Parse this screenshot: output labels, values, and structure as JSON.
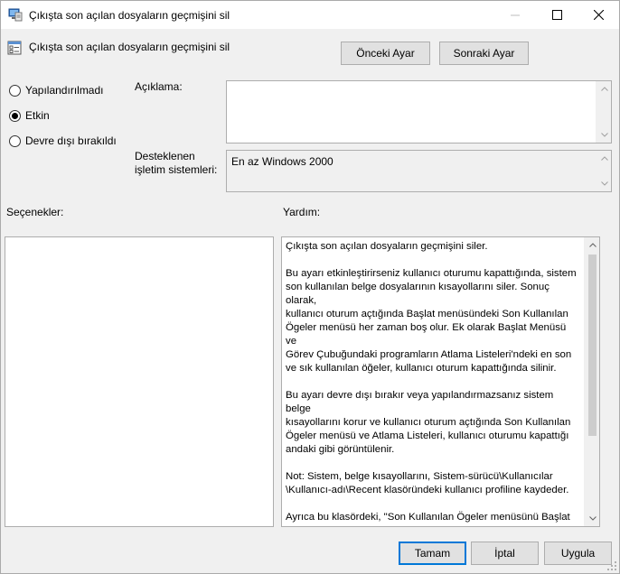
{
  "window": {
    "title": "Çıkışta son açılan dosyaların geçmişini sil",
    "controls": {
      "minimize": "minimize-icon",
      "maximize": "maximize-icon",
      "close": "close-icon"
    }
  },
  "header": {
    "setting_title": "Çıkışta son açılan dosyaların geçmişini sil",
    "prev_button": "Önceki Ayar",
    "next_button": "Sonraki Ayar"
  },
  "state": {
    "options": [
      {
        "label": "Yapılandırılmadı",
        "checked": false
      },
      {
        "label": "Etkin",
        "checked": true
      },
      {
        "label": "Devre dışı bırakıldı",
        "checked": false
      }
    ]
  },
  "description": {
    "label": "Açıklama:",
    "value": ""
  },
  "supported": {
    "label_line1": "Desteklenen",
    "label_line2": "işletim sistemleri:",
    "value": "En az Windows 2000"
  },
  "options_panel": {
    "label": "Seçenekler:"
  },
  "help_panel": {
    "label": "Yardım:",
    "paragraphs": [
      "Çıkışta son açılan dosyaların geçmişini siler.",
      "Bu ayarı etkinleştirirseniz kullanıcı oturumu kapattığında, sistem\nson kullanılan belge dosyalarının kısayollarını siler. Sonuç olarak,\nkullanıcı oturum açtığında Başlat menüsündeki Son Kullanılan\nÖgeler menüsü her zaman boş olur. Ek olarak Başlat Menüsü ve\nGörev Çubuğundaki programların Atlama Listeleri'ndeki en son\nve sık kullanılan öğeler, kullanıcı oturum kapattığında silinir.",
      "Bu ayarı devre dışı bırakır veya yapılandırmazsanız sistem belge\nkısayollarını korur ve kullanıcı oturum açtığında Son Kullanılan\nÖgeler menüsü ve Atlama Listeleri, kullanıcı oturumu kapattığı\nandaki gibi görüntülenir.",
      "Not: Sistem, belge kısayollarını, Sistem-sürücü\\Kullanıcılar\n\\Kullanıcı-adı\\Recent klasöründeki kullanıcı profiline kaydeder.",
      "Ayrıca bu klasördeki, \"Son Kullanılan Ögeler menüsünü Başlat\nMenüsü'nden kaldır\" ve Son açılan belgelerin geçmişini tutma\"\nilkelerine de bakın. Sistem bu ayarı yalnızca ilgili ayarlardan\nhiçbiri seçilmediği zamanlarda kullanır."
    ]
  },
  "footer": {
    "ok": "Tamam",
    "cancel": "İptal",
    "apply": "Uygula"
  }
}
